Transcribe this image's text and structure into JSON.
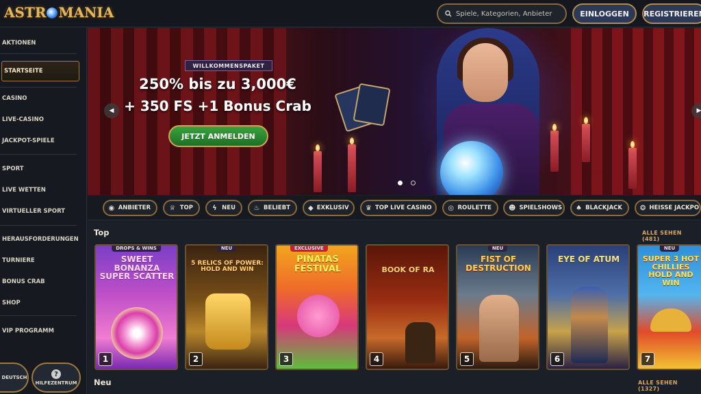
{
  "header": {
    "logo_text": "ASTROMANIA",
    "search_placeholder": "Spiele, Kategorien, Anbieter",
    "login_label": "EINLOGGEN",
    "register_label": "REGISTRIEREN"
  },
  "sidebar": {
    "items": [
      {
        "label": "AKTIONEN"
      },
      {
        "label": "STARTSEITE",
        "active": true
      },
      {
        "label": "CASINO"
      },
      {
        "label": "LIVE-CASINO"
      },
      {
        "label": "JACKPOT-SPIELE"
      },
      {
        "label": "SPORT"
      },
      {
        "label": "LIVE WETTEN"
      },
      {
        "label": "VIRTUELLER SPORT"
      },
      {
        "label": "HERAUSFORDERUNGEN"
      },
      {
        "label": "TURNIERE"
      },
      {
        "label": "BONUS CRAB"
      },
      {
        "label": "SHOP"
      },
      {
        "label": "VIP PROGRAMM"
      }
    ],
    "language_label": "DEUTSCH",
    "help_label": "HILFEZENTRUM",
    "help_icon": "?"
  },
  "hero": {
    "badge": "WILLKOMMENSPAKET",
    "line1": "250% bis zu 3,000€",
    "line2": "+ 350 FS +1 Bonus Crab",
    "cta_label": "JETZT ANMELDEN",
    "slides": 2,
    "active_slide": 1
  },
  "categories": [
    {
      "label": "ANBIETER",
      "icon": "provider-icon"
    },
    {
      "label": "TOP",
      "icon": "trophy-icon"
    },
    {
      "label": "NEU",
      "icon": "lightning-icon"
    },
    {
      "label": "BELIEBT",
      "icon": "flame-icon"
    },
    {
      "label": "EXKLUSIV",
      "icon": "diamond-icon"
    },
    {
      "label": "TOP LIVE CASINO",
      "icon": "crown-icon"
    },
    {
      "label": "ROULETTE",
      "icon": "roulette-icon"
    },
    {
      "label": "SPIELSHOWS",
      "icon": "show-icon"
    },
    {
      "label": "BLACKJACK",
      "icon": "cards-icon"
    },
    {
      "label": "HEISSE JACKPOTS",
      "icon": "jackpot-icon"
    }
  ],
  "sections": {
    "top": {
      "title": "Top",
      "see_all": "ALLE SEHEN (481)"
    },
    "new": {
      "title": "Neu",
      "see_all": "ALLE SEHEN (1327)"
    }
  },
  "games": [
    {
      "rank": "1",
      "tag": "DROPS & WINS",
      "name": "SWEET BONANZA SUPER SCATTER"
    },
    {
      "rank": "2",
      "tag": "NEU",
      "name": "5 RELICS OF POWER: HOLD AND WIN"
    },
    {
      "rank": "3",
      "tag": "EXCLUSIVE",
      "name": "PIÑATAS FESTIVAL"
    },
    {
      "rank": "4",
      "tag": "",
      "name": "BOOK OF RA"
    },
    {
      "rank": "5",
      "tag": "NEU",
      "name": "FIST OF DESTRUCTION"
    },
    {
      "rank": "6",
      "tag": "",
      "name": "EYE OF ATUM"
    },
    {
      "rank": "7",
      "tag": "NEU",
      "name": "SUPER 3 HOT CHILLIES HOLD AND WIN"
    }
  ],
  "colors": {
    "accent_gold": "#b58b4a",
    "background": "#1b1f27",
    "cta_green": "#2f8f33",
    "button_blue": "#2d3a57"
  }
}
